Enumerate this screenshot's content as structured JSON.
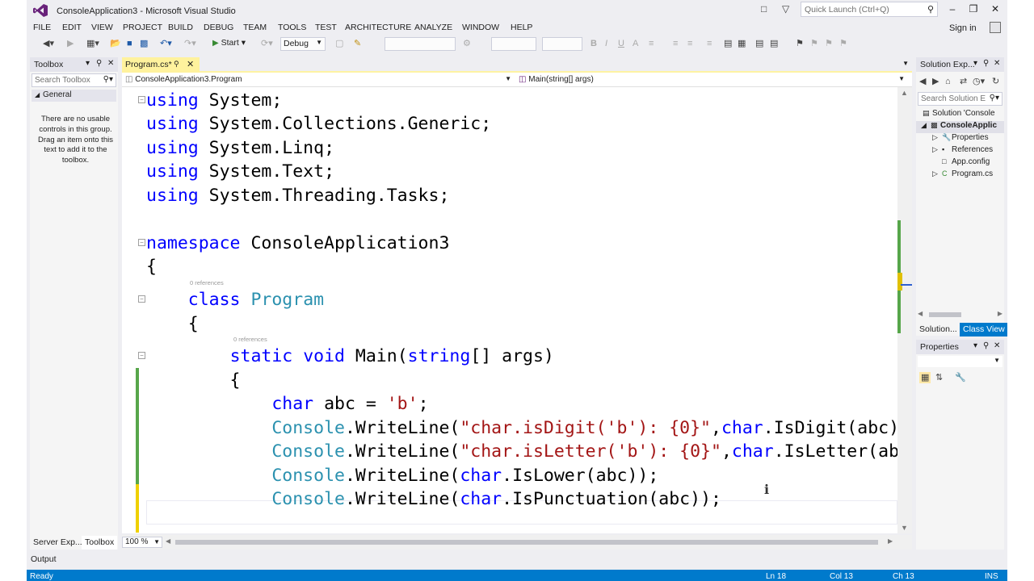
{
  "window": {
    "title": "ConsoleApplication3 - Microsoft Visual Studio",
    "quick_launch_placeholder": "Quick Launch (Ctrl+Q)",
    "sign_in": "Sign in"
  },
  "menu": [
    "FILE",
    "EDIT",
    "VIEW",
    "PROJECT",
    "BUILD",
    "DEBUG",
    "TEAM",
    "TOOLS",
    "TEST",
    "ARCHITECTURE",
    "ANALYZE",
    "WINDOW",
    "HELP"
  ],
  "toolbar": {
    "start_label": "Start",
    "configuration": "Debug"
  },
  "toolbox": {
    "title": "Toolbox",
    "search_placeholder": "Search Toolbox",
    "group": "General",
    "empty_message": "There are no usable controls in this group. Drag an item onto this text to add it to the toolbox.",
    "bottom_tabs": [
      "Server Exp...",
      "Toolbox"
    ]
  },
  "editor": {
    "tab_label": "Program.cs*",
    "nav_left": "ConsoleApplication3.Program",
    "nav_right": "Main(string[] args)",
    "zoom": "100 %",
    "codelens_class": "0 references",
    "codelens_method": "0 references"
  },
  "solution_explorer": {
    "title": "Solution Exp...",
    "search_placeholder": "Search Solution E",
    "items": [
      "Solution 'Console",
      "ConsoleApplic",
      "Properties",
      "References",
      "App.config",
      "Program.cs"
    ],
    "tabs": [
      "Solution...",
      "Class View"
    ]
  },
  "properties": {
    "title": "Properties"
  },
  "output": {
    "label": "Output"
  },
  "status": {
    "ready": "Ready",
    "line": "Ln 18",
    "col": "Col 13",
    "ch": "Ch 13",
    "mode": "INS"
  },
  "colors": {
    "keyword": "#0000ff",
    "type": "#2b91af",
    "string": "#a31515",
    "status_bar": "#007acc",
    "active_tab": "#fff29d"
  }
}
